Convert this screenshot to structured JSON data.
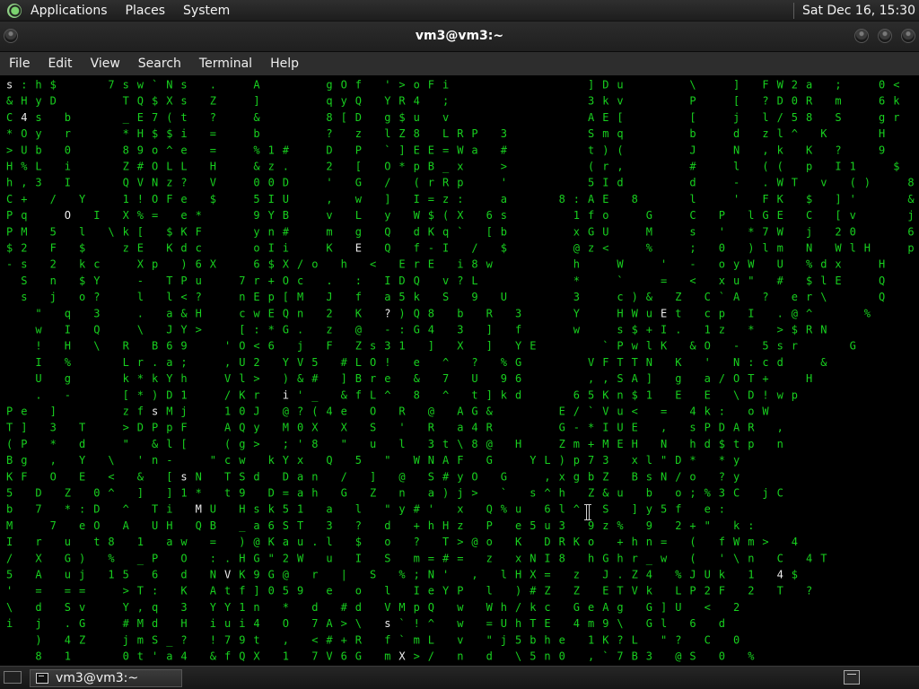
{
  "top_panel": {
    "applications": "Applications",
    "places": "Places",
    "system": "System",
    "clock": "Sat Dec 16, 15:30"
  },
  "window": {
    "title": "vm3@vm3:~"
  },
  "menu": {
    "items": [
      "File",
      "Edit",
      "View",
      "Search",
      "Terminal",
      "Help"
    ]
  },
  "terminal": {
    "matrix_lines": [
      "s:h$   7sw`Ns .  A    gOf '>oFi         ]Du    \\  ] FW2a ;  0<",
      "&HyD    TQ$Xs Z  ]    qyQ YR4 ;         3kv    P  [ ?D0R m  6k",
      "C4s b   _E7(t ?  &    8[D g$u v         AE[    [  j l/58 S  gr",
      "*Oy r   *H$$i =  b    ? z lZ8 LRP 3     Smq    b  d zl^ K   H",
      ">Ub 0   89o^e =  %1#  D P `]EE=Wa #     t)(    J  N ,k K ?  9",
      "H%L i   Z#OLL H  &z.  2 [ O*pB_x  >     (r,    #  l (( p I1  $",
      "h,3 I   QVNz? V  00D  ' G / (rRp  '     5Id    d  - .WT v ()  85",
      "C+ / Y  1!OFe $  5IU  , w ] I=z:  a   8:AE 8   l  ' FK $ ]'   &B",
      "Pq  O I X%= e*   9YB  v L y W$(X 6s    1fo  G  C P lGE C [v   j>",
      "PM 5 l \\k[ $KF   yn#  m g Q dKq` [b    xGU  M  s ' *7W j 20   6",
      "$2 F $  zE Kdc   oIi  K E Q f-I / $    @z<  %  ; 0 )lm N WlH  p",
      "-s 2 kc  Xp )6X  6$X/o h < ErE i8w     h  W  ' - oyW U %dx  H",
      " S n $Y  - TPu  7r+Oc . : IDQ v?L      *  `  = < xu\" # $lE  Q",
      " s j o?  l l<?  nEp[M J f a5k S 9 U    3  c)& Z C`A ? er\\   Q",
      "  \" q 3  . a&H  cwEQn 2 K ?)Q8 b R 3   Y  HWuEt cp I .@^   %",
      "  w I Q  \\ JY>  [:*G. z @ -:G4 3 ] f   w  s$+I. 1z * >$RN  ",
      "  ! H \\ R B69  'O<6 j F Zs31 ] X ] YE    `PwlK &O - 5sr   G",
      "  I %   Lr.a;  ,U2 YV5 #LO! e ^ ? %G    VFTTN K ' N:cd  &",
      "  U g   k*kYh  Vl> )&# ]Bre & 7 U 96    ,,SA] g a/OT+  H",
      "  . -   [*)D1  /Kr i'_ &fL^ 8 ^ t]kd   65Kn$1 E E \\D!wp",
      "Pe ]    zfsMj  10J @?(4e O R @ AG&    E/`Vu< = 4k: oW",
      "T] 3 T  >DPpF  AQy M0X X S ' R a4R    G-*IUE , sPDAR ,",
      "(P * d  \" &l[  (g> ;'8 \" u l 3t\\8@ H  Zm+MEH N hd$tp n",
      "Bg , Y \\ 'n-  \"cw kYx Q 5 \" WNAF G  YL)p73 xl\"D* *y",
      "KF O E < & [sN TSd Dan / ] @ S#yO G  ,xgbZ BsN/o ?y",
      "5 D Z 0^ ] ]1* t9 D=ah G Z n a)j> ` s^h Z&u b o;%3C jC",
      "b 7 *:D ^ Ti MU Hsk51 a l \"y#' x Q%u 6l^ S ]y5f e:",
      "M  7 eO A UH QB _a6ST 3 ? d +hHz P e5u3 9z% 9 2+\" k:",
      "I r u t8 1 aw = )@Kau.l $ o ? T>@o K DRKo +hn= ( fWm> 4",
      "/ X G) % _P O :.HG\"2W u I S m=#= z xNI8 hGhr_w ( '\\n C 4T",
      "5 A uj 15 6 d NVK9G@ r | S %;N' , lHX= z J.Z4 %JUk 1 4$",
      "' = ==  >T: K Atf]059 e o l IeYP l )#Z Z ETVk LP2F 2 T ?",
      "\\ d Sv  Y,q 3 YY1n * d #d VMpQ w Wh/kc GeAg G]U < 2",
      "i j .G  #Md H iui4 O 7A>\\ s`!^ w =UhTE 4m9\\ Gl 6 d",
      "  ) 4Z  jmS_? !79t , <#+R f`mL v \"j5bhe 1K?L \"? C 0",
      "  8 1   0t'a4 &fQX 1 7V6G mX>/ n d \\5n0 ,`7B3 @S 0 %"
    ]
  }
}
